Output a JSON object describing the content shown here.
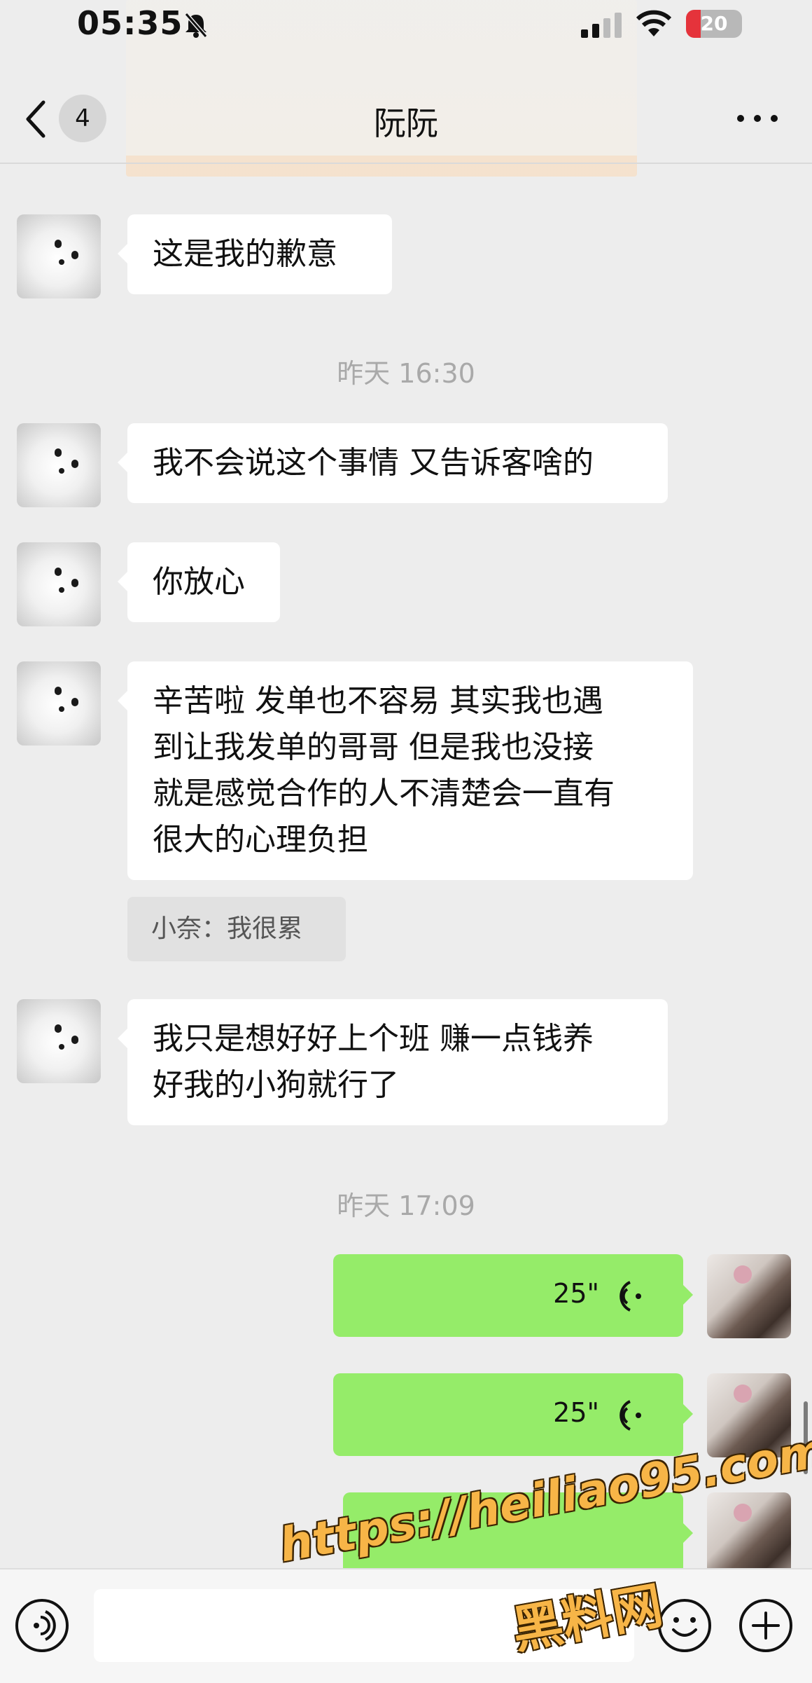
{
  "status_bar": {
    "time": "05:35",
    "battery": "20"
  },
  "header": {
    "unread_count": "4",
    "title": "阮阮"
  },
  "messages": [
    {
      "text": "这是我的歉意"
    },
    {
      "text": "我不会说这个事情 又告诉客啥的"
    },
    {
      "text": "你放心"
    },
    {
      "lines": [
        "辛苦啦 发单也不容易 其实我也遇",
        "到让我发单的哥哥 但是我也没接",
        "就是感觉合作的人不清楚会一直有",
        "很大的心理负担"
      ]
    },
    {
      "lines": [
        "我只是想好好上个班 赚一点钱养",
        "好我的小狗就行了"
      ]
    }
  ],
  "quote": {
    "text": "小奈：我很累"
  },
  "timestamps": [
    "昨天 16:30",
    "昨天 17:09"
  ],
  "voice_messages": [
    {
      "duration": "25\""
    },
    {
      "duration": "25\""
    }
  ],
  "watermark": {
    "url": "https://heiliao95.com",
    "name": "黑料网"
  },
  "icons": [
    "bell-muted-icon",
    "signal-icon",
    "wifi-icon",
    "back-icon",
    "more-icon",
    "voice-input-icon",
    "emoji-icon",
    "plus-icon",
    "voice-wave-icon"
  ],
  "colors": {
    "background": "#ededed",
    "bubble_in": "#ffffff",
    "bubble_out": "#95ec69",
    "battery_low": "#e5333b"
  }
}
